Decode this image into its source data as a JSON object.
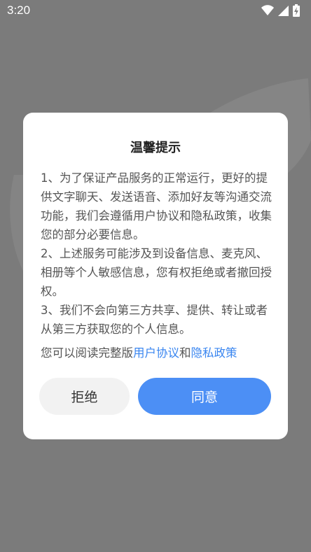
{
  "status_bar": {
    "time": "3:20",
    "icons": [
      "wifi-icon",
      "cellular-signal-icon",
      "battery-charging-icon"
    ]
  },
  "dialog": {
    "title": "温馨提示",
    "paragraphs": [
      "1、为了保证产品服务的正常运行，更好的提供文字聊天、发送语音、添加好友等沟通交流功能，我们会遵循用户协议和隐私政策，收集您的部分必要信息。",
      "2、上述服务可能涉及到设备信息、麦克风、相册等个人敏感信息，您有权拒绝或者撤回授权。",
      "3、我们不会向第三方共享、提供、转让或者从第三方获取您的个人信息。"
    ],
    "read_prefix": "您可以阅读完整版",
    "user_agreement_link": "用户协议",
    "conjunction": "和",
    "privacy_policy_link": "隐私政策",
    "reject_label": "拒绝",
    "accept_label": "同意"
  },
  "colors": {
    "overlay": "#7b7b7b",
    "dialog_bg": "#ffffff",
    "accent": "#4c8ff5",
    "link": "#3a86f0",
    "reject_bg": "#f2f2f2"
  }
}
